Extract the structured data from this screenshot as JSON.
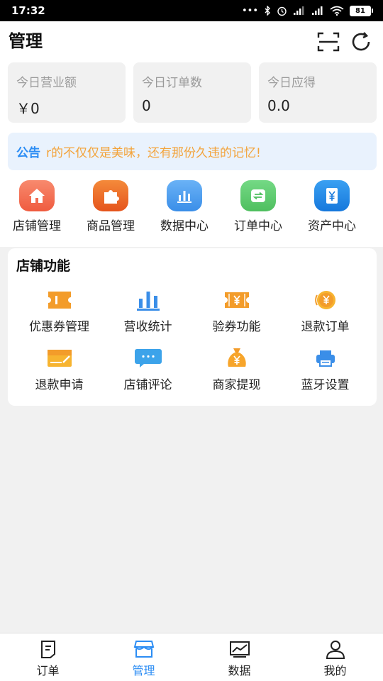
{
  "status_bar": {
    "time": "17:32",
    "dots": "•••",
    "battery": "81"
  },
  "header": {
    "title": "管理"
  },
  "stats": [
    {
      "label": "今日营业额",
      "value": "￥0"
    },
    {
      "label": "今日订单数",
      "value": "0"
    },
    {
      "label": "今日应得",
      "value": "0.0"
    }
  ],
  "notice": {
    "label": "公告",
    "text": "r的不仅仅是美味，还有那份久违的记忆!"
  },
  "quick_nav": [
    {
      "label": "店铺管理",
      "icon": "home-icon",
      "color": "#f26a4f"
    },
    {
      "label": "商品管理",
      "icon": "puzzle-icon",
      "color": "#ef6a22"
    },
    {
      "label": "数据中心",
      "icon": "bar-chart-icon",
      "color": "#3f97f1"
    },
    {
      "label": "订单中心",
      "icon": "exchange-icon",
      "color": "#5dcb6a"
    },
    {
      "label": "资产中心",
      "icon": "yen-icon",
      "color": "#1e8de8"
    }
  ],
  "functions": {
    "title": "店铺功能",
    "items": [
      {
        "label": "优惠券管理",
        "icon": "coupon-icon"
      },
      {
        "label": "营收统计",
        "icon": "revenue-chart-icon"
      },
      {
        "label": "验券功能",
        "icon": "ticket-yen-icon"
      },
      {
        "label": "退款订单",
        "icon": "refund-coin-icon"
      },
      {
        "label": "退款申请",
        "icon": "refund-form-icon"
      },
      {
        "label": "店铺评论",
        "icon": "comment-icon"
      },
      {
        "label": "商家提现",
        "icon": "money-bag-icon"
      },
      {
        "label": "蓝牙设置",
        "icon": "printer-icon"
      }
    ]
  },
  "bottom_nav": [
    {
      "label": "订单",
      "icon": "order-icon",
      "active": false
    },
    {
      "label": "管理",
      "icon": "store-icon",
      "active": true
    },
    {
      "label": "数据",
      "icon": "data-chart-icon",
      "active": false
    },
    {
      "label": "我的",
      "icon": "user-icon",
      "active": false
    }
  ],
  "colors": {
    "accent": "#2c8df4",
    "notice_text": "#f3a33a",
    "coupon": "#f39c2a",
    "blue_icon": "#3a8ee8"
  }
}
